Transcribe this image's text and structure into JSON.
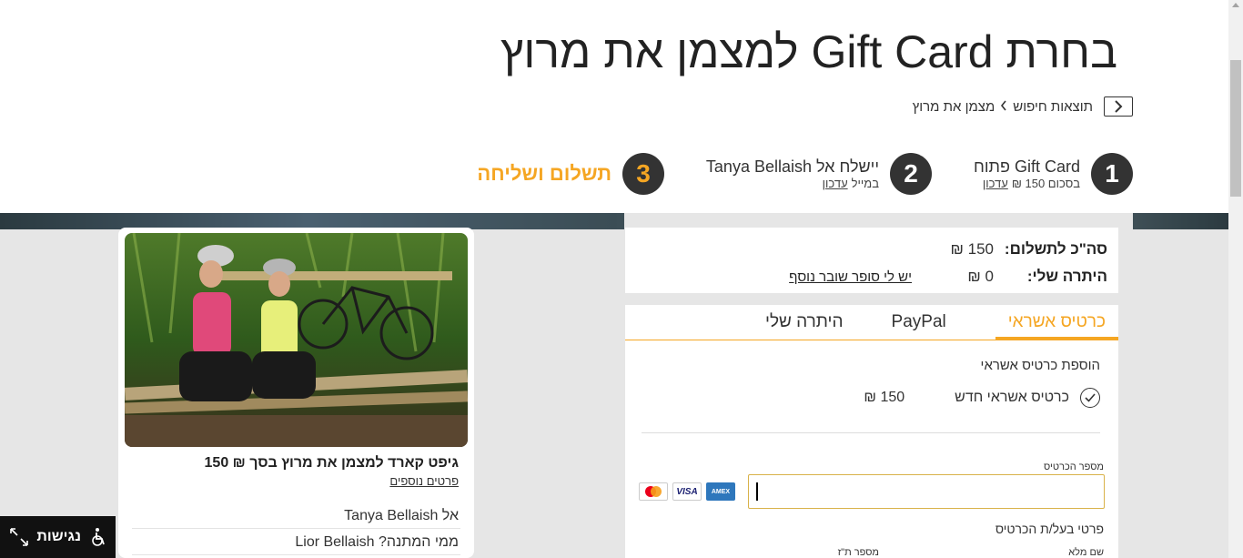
{
  "header": {
    "title": "בחרת Gift Card למצמן את מרוץ",
    "breadcrumb": {
      "back_icon": "chevron-left-icon",
      "items": [
        "תוצאות חיפוש",
        "מצמן את מרוץ"
      ],
      "separator_icon": "chevron-left-icon"
    }
  },
  "steps": [
    {
      "number": "1",
      "title": "Gift Card פתוח",
      "subtitle": "בסכום 150 ₪",
      "edit": "עדכון"
    },
    {
      "number": "2",
      "title": "יישלח אל Tanya Bellaish",
      "subtitle": "במייל",
      "edit": "עדכון"
    },
    {
      "number": "3",
      "title": "תשלום ושליחה"
    }
  ],
  "summary": {
    "total_label": "סה\"כ לתשלום:",
    "total_value": "150 ₪",
    "balance_label": "היתרה שלי:",
    "balance_value": "0 ₪",
    "voucher_link": "יש לי סופר שובר נוסף"
  },
  "payment": {
    "tabs": [
      {
        "label": "כרטיס אשראי",
        "active": true
      },
      {
        "label": "PayPal",
        "active": false
      },
      {
        "label": "היתרה שלי",
        "active": false
      }
    ],
    "add_card_label": "הוספת כרטיס אשראי",
    "new_card_option": "כרטיס אשראי חדש",
    "new_card_amount": "150 ₪",
    "card_number_label": "מספר הכרטיס",
    "card_number_value": "",
    "card_logos": [
      "amex",
      "visa",
      "mastercard"
    ],
    "owner_details_label": "פרטי בעל/ת הכרטיס",
    "full_name_label": "שם מלא",
    "id_label": "מספר ת\"ז"
  },
  "gift": {
    "title": "גיפט קארד למצמן את מרוץ בסך ₪ 150",
    "more_details": "פרטים נוספים",
    "to_row": "אל  Tanya Bellaish",
    "from_row": "ממי המתנה?  Lior Bellaish"
  },
  "accessibility": {
    "label": "נגישות",
    "icon": "wheelchair-icon",
    "expand_icon": "expand-icon"
  },
  "colors": {
    "accent": "#f5a623",
    "dark": "#333333"
  }
}
